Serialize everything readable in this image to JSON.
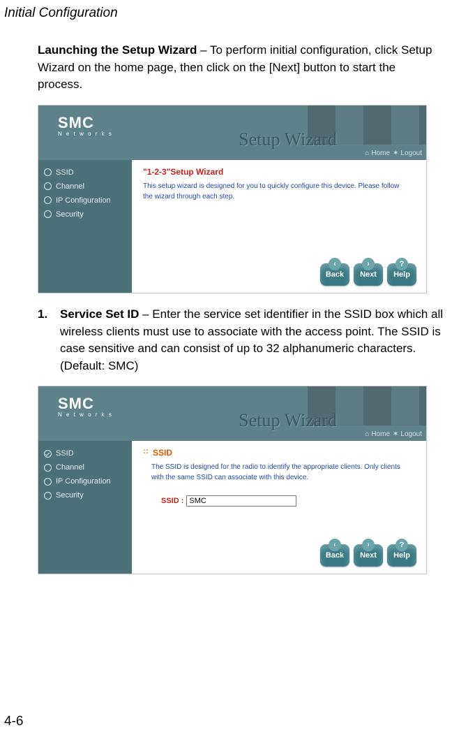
{
  "page_header": "Initial Configuration",
  "page_number": "4-6",
  "intro": {
    "bold": "Launching the Setup Wizard",
    "rest": " – To perform initial configuration, click Setup Wizard on the home page, then click on the [Next] button to start the process."
  },
  "step1": {
    "number": "1.",
    "bold": "Service Set ID",
    "rest": " – Enter the service set identifier in the SSID box which all wireless clients must use to associate with the access point. The SSID is case sensitive and can consist of up to 32 alphanumeric characters.",
    "default_line": "(Default: SMC)"
  },
  "shot_common": {
    "logo": "SMC",
    "logo_sub": "N e t w o r k s",
    "banner": "Setup Wizard",
    "nav_home": "Home",
    "nav_logout": "Logout",
    "sidebar": {
      "ssid": "SSID",
      "channel": "Channel",
      "ipconf": "IP Configuration",
      "security": "Security"
    },
    "buttons": {
      "back": "Back",
      "next": "Next",
      "help": "Help"
    }
  },
  "shot1": {
    "title": "\"1-2-3\"Setup Wizard",
    "desc": "This setup wizard is designed for you to quickly configure this device. Please follow the wizard through each step."
  },
  "shot2": {
    "title": "SSID",
    "desc": "The SSID is designed for the radio to identify the appropriate clients. Only clients with the same SSID can associate with this device.",
    "ssid_label": "SSID :",
    "ssid_value": "SMC"
  }
}
